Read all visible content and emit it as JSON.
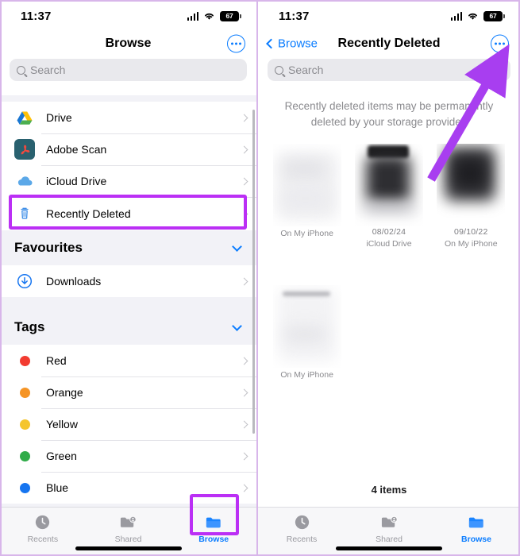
{
  "status": {
    "time": "11:37",
    "battery_level": "67",
    "cellular_icon": "signal-bars-icon",
    "wifi_icon": "wifi-icon",
    "battery_icon": "battery-icon"
  },
  "left_panel": {
    "nav": {
      "title": "Browse",
      "more_icon": "ellipsis-circle-icon"
    },
    "search": {
      "placeholder": "Search",
      "icon": "search-icon"
    },
    "locations": [
      {
        "label": "Drive",
        "icon": "google-drive-icon"
      },
      {
        "label": "Adobe Scan",
        "icon": "adobe-scan-icon"
      },
      {
        "label": "iCloud Drive",
        "icon": "icloud-icon"
      },
      {
        "label": "Recently Deleted",
        "icon": "trash-icon",
        "highlighted": true
      }
    ],
    "favourites": {
      "title": "Favourites",
      "collapse_icon": "chevron-down-icon",
      "items": [
        {
          "label": "Downloads",
          "icon": "download-circle-icon"
        }
      ]
    },
    "tags": {
      "title": "Tags",
      "collapse_icon": "chevron-down-icon",
      "items": [
        {
          "label": "Red",
          "color": "#f23b30"
        },
        {
          "label": "Orange",
          "color": "#f59425"
        },
        {
          "label": "Yellow",
          "color": "#f5c52c"
        },
        {
          "label": "Green",
          "color": "#30ac49"
        },
        {
          "label": "Blue",
          "color": "#1675f0"
        }
      ]
    }
  },
  "right_panel": {
    "nav": {
      "back_label": "Browse",
      "title": "Recently Deleted",
      "more_icon": "ellipsis-circle-icon",
      "back_icon": "chevron-left-icon"
    },
    "search": {
      "placeholder": "Search",
      "icon": "search-icon"
    },
    "notice": "Recently deleted items may be permanently deleted by your storage provider.",
    "files": [
      {
        "date": "",
        "location": "On My iPhone"
      },
      {
        "date": "08/02/24",
        "location": "iCloud Drive"
      },
      {
        "date": "09/10/22",
        "location": "On My iPhone"
      },
      {
        "date": "",
        "location": "On My iPhone"
      }
    ],
    "item_count": "4 items"
  },
  "tabbar": {
    "tabs": [
      {
        "label": "Recents",
        "icon": "clock-icon",
        "active": false
      },
      {
        "label": "Shared",
        "icon": "shared-folder-icon",
        "active": false
      },
      {
        "label": "Browse",
        "icon": "folder-icon",
        "active": true
      }
    ]
  },
  "annotations": {
    "highlight_color": "#bb2ff5",
    "arrow_color": "#a83ef0",
    "targets": [
      "recently-deleted-row",
      "browse-tab",
      "more-button"
    ]
  }
}
